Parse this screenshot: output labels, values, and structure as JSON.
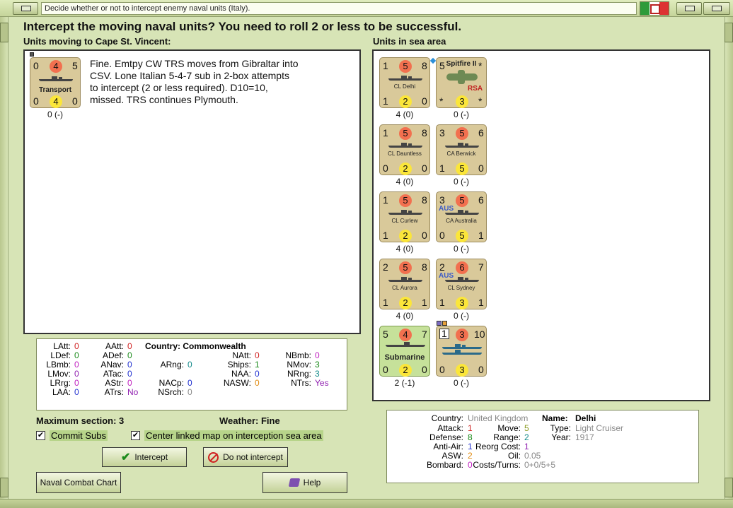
{
  "window": {
    "title": "Decide whether or not to intercept enemy naval units (Italy)."
  },
  "heading": "Intercept the moving naval units?  You need to roll 2 or less to be successful.",
  "moving": {
    "label": "Units moving to Cape St. Vincent:",
    "counter": {
      "tl": "0",
      "att": "4",
      "tr": "5",
      "name": "Transport",
      "bl": "0",
      "def": "4",
      "br": "0",
      "caption": "0 (-)"
    },
    "message_lines": [
      "Fine.  Emtpy CW TRS moves from Gibraltar into",
      "CSV.   Lone Italian 5-4-7 sub in 2-box attempts",
      "to intercept (2 or less required).  D10=10,",
      "missed.  TRS continues Plymouth."
    ]
  },
  "sea_area": {
    "label": "Units in sea area",
    "counters": [
      {
        "tl": "1",
        "att": "5",
        "tr": "8",
        "name": "CL Delhi",
        "bl": "1",
        "def": "2",
        "br": "0",
        "caption": "4 (0)",
        "flag": ""
      },
      {
        "tl": "5",
        "att": "",
        "tr": "*",
        "name": "Spitfire II",
        "bl": "*",
        "def": "3",
        "br": "*",
        "caption": "0 (-)",
        "flag": "RSA"
      },
      {
        "tl": "1",
        "att": "5",
        "tr": "8",
        "name": "CL Dauntless",
        "bl": "0",
        "def": "2",
        "br": "0",
        "caption": "4 (0)",
        "flag": ""
      },
      {
        "tl": "3",
        "att": "5",
        "tr": "6",
        "name": "CA Berwick",
        "bl": "1",
        "def": "5",
        "br": "0",
        "caption": "0 (-)",
        "flag": ""
      },
      {
        "tl": "1",
        "att": "5",
        "tr": "8",
        "name": "CL Curlew",
        "bl": "1",
        "def": "2",
        "br": "0",
        "caption": "4 (0)",
        "flag": ""
      },
      {
        "tl": "3",
        "att": "5",
        "tr": "6",
        "name": "CA Australia",
        "bl": "0",
        "def": "5",
        "br": "1",
        "caption": "0 (-)",
        "flag": "AUS"
      },
      {
        "tl": "2",
        "att": "5",
        "tr": "8",
        "name": "CL Aurora",
        "bl": "1",
        "def": "2",
        "br": "1",
        "caption": "4 (0)",
        "flag": ""
      },
      {
        "tl": "2",
        "att": "6",
        "tr": "7",
        "name": "CL Sydney",
        "bl": "1",
        "def": "3",
        "br": "1",
        "caption": "0 (-)",
        "flag": "AUS"
      },
      {
        "tl": "5",
        "att": "4",
        "tr": "7",
        "name": "Submarine",
        "bl": "0",
        "def": "2",
        "br": "0",
        "caption": "2 (-1)",
        "flag": ""
      },
      {
        "tl": "1",
        "att": "3",
        "tr": "10",
        "name": "",
        "bl": "0",
        "def": "3",
        "br": "0",
        "caption": "0 (-)",
        "flag": ""
      }
    ]
  },
  "stats": {
    "country_label": "Country:",
    "country_value": "Commonwealth",
    "rows": [
      {
        "k": "LAtt:",
        "v": "0"
      },
      {
        "k": "LDef:",
        "v": "0"
      },
      {
        "k": "LBmb:",
        "v": "0"
      },
      {
        "k": "LMov:",
        "v": "0"
      },
      {
        "k": "LRrg:",
        "v": "0"
      },
      {
        "k": "LAA:",
        "v": "0"
      },
      {
        "k": "AAtt:",
        "v": "0"
      },
      {
        "k": "ADef:",
        "v": "0"
      },
      {
        "k": "ANav:",
        "v": "0"
      },
      {
        "k": "ATac:",
        "v": "0"
      },
      {
        "k": "AStr:",
        "v": "0"
      },
      {
        "k": "ATrs:",
        "v": "No"
      },
      {
        "k": "ARng:",
        "v": "0"
      },
      {
        "k": "NACp:",
        "v": "0"
      },
      {
        "k": "NSrch:",
        "v": "0"
      },
      {
        "k": "NAtt:",
        "v": "0"
      },
      {
        "k": "Ships:",
        "v": "1"
      },
      {
        "k": "NAA:",
        "v": "0"
      },
      {
        "k": "NASW:",
        "v": "0"
      },
      {
        "k": "NBmb:",
        "v": "0"
      },
      {
        "k": "NMov:",
        "v": "3"
      },
      {
        "k": "NRng:",
        "v": "3"
      },
      {
        "k": "NTrs:",
        "v": "Yes"
      }
    ]
  },
  "max_section": "Maximum section: 3",
  "weather": "Weather:  Fine",
  "commit_subs": "Commit Subs",
  "center_map": "Center linked map on interception sea area",
  "buttons": {
    "intercept": "Intercept",
    "no_intercept": "Do not intercept",
    "chart": "Naval Combat Chart",
    "help": "Help"
  },
  "unit_info": {
    "country_k": "Country:",
    "country_v": "United Kingdom",
    "name_k": "Name:",
    "name_v": "Delhi",
    "type_k": "Type:",
    "type_v": "Light Cruiser",
    "year_k": "Year:",
    "year_v": "1917",
    "attack_k": "Attack:",
    "attack_v": "1",
    "defense_k": "Defense:",
    "defense_v": "8",
    "aa_k": "Anti-Air:",
    "aa_v": "1",
    "asw_k": "ASW:",
    "asw_v": "2",
    "bombard_k": "Bombard:",
    "bombard_v": "0",
    "move_k": "Move:",
    "move_v": "5",
    "range_k": "Range:",
    "range_v": "2",
    "reorg_k": "Reorg Cost:",
    "reorg_v": "1",
    "oil_k": "Oil:",
    "oil_v": "0.05",
    "costs_k": "Costs/Turns:",
    "costs_v": "0+0/5+5"
  },
  "colors": {
    "frame": "#d7e4b6",
    "attack_circle": "#f2704f",
    "defense_circle": "#fbe63a",
    "counter": "#d9c99a",
    "sub_counter": "#c6e19a"
  }
}
